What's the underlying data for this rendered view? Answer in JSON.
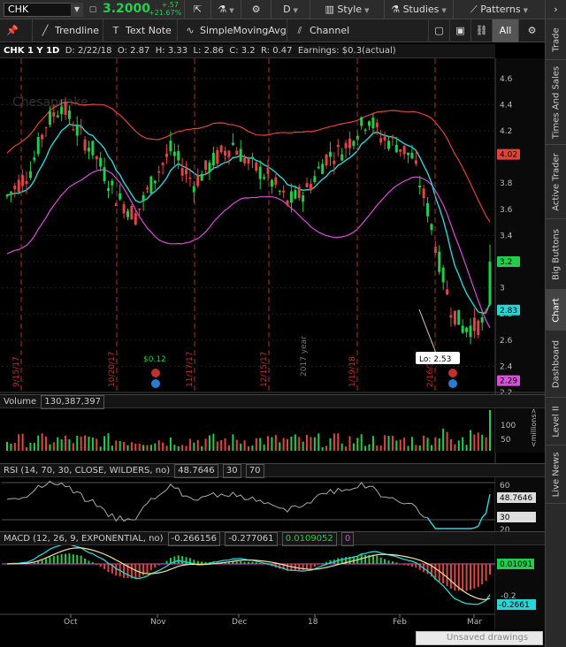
{
  "topbar": {
    "symbol": "CHK",
    "last_price": "3.2000",
    "net_change": "+.57",
    "net_change_pct": "+21.67%",
    "buttons": [
      {
        "name": "share-button",
        "icon": "share-icon",
        "label": ""
      },
      {
        "name": "flask-button",
        "icon": "flask-icon",
        "label": ""
      },
      {
        "name": "settings-button",
        "icon": "gear-icon",
        "label": ""
      },
      {
        "name": "aggregation-button",
        "icon": "",
        "label": "D"
      },
      {
        "name": "style-button",
        "icon": "bars-icon",
        "label": "Style"
      },
      {
        "name": "studies-button",
        "icon": "flask-icon",
        "label": "Studies"
      },
      {
        "name": "patterns-button",
        "icon": "pattern-icon",
        "label": "Patterns"
      }
    ]
  },
  "drawbar": {
    "pin_icon": "pin-icon",
    "trendline": "Trendline",
    "textnote": "Text Note",
    "sma": "SimpleMovingAvg",
    "channel": "Channel",
    "all": "All"
  },
  "sidetabs": [
    "Trade",
    "Times And Sales",
    "Active Trader",
    "Big Buttons",
    "Chart",
    "Dashboard",
    "Level II",
    "Live News"
  ],
  "chart_header": {
    "symbol": "CHK 1 Y 1D",
    "date": "D: 2/22/18",
    "open": "O: 2.87",
    "high": "H: 3.33",
    "low": "L: 2.86",
    "close": "C: 3.2",
    "range": "R: 0.47",
    "earnings": "Earnings: $0.3(actual)"
  },
  "price_axis": {
    "ticks": [
      "4.6",
      "4.4",
      "4.2",
      "4",
      "3.8",
      "3.6",
      "3.4",
      "3.2",
      "3",
      "2.8",
      "2.6",
      "2.4",
      "2.2"
    ],
    "badges": [
      {
        "label": "4.02",
        "value": 4.02,
        "color": "#e0453a"
      },
      {
        "label": "3.2",
        "value": 3.2,
        "color": "#1fcf4a"
      },
      {
        "label": "2.83",
        "value": 2.83,
        "color": "#29d6d6"
      },
      {
        "label": "2.29",
        "value": 2.29,
        "color": "#d84fd8"
      }
    ]
  },
  "event_markers": {
    "dates": [
      "9/15/17",
      "10/20/17",
      "11/17/17",
      "12/15/17",
      "1/19/18",
      "2/16/18"
    ],
    "year_label": "2017 year",
    "dividend": "$0.12",
    "low_label": "Lo: 2.53",
    "watermark": "Chesapeake"
  },
  "volume_panel": {
    "label": "Volume",
    "value": "130,387,397",
    "axis_ticks": [
      "100",
      "50"
    ],
    "unit": "<millions>"
  },
  "rsi_panel": {
    "label": "RSI (14, 70, 30, CLOSE, WILDERS, no)",
    "value": "48.7646",
    "low": "30",
    "high": "70",
    "axis_ticks": [
      "60",
      "48.7646",
      "30",
      "20"
    ]
  },
  "macd_panel": {
    "label": "MACD (12, 26, 9, EXPONENTIAL, no)",
    "value": "-0.266156",
    "avg": "-0.277061",
    "diff": "0.0109052",
    "zero": "0",
    "axis_ticks": [
      "0.01091",
      "-0.2",
      "-0.2661"
    ]
  },
  "time_axis": [
    "Oct",
    "Nov",
    "Dec",
    "18",
    "Feb",
    "Mar"
  ],
  "unsaved": "Unsaved drawings",
  "chart_data": {
    "type": "candlestick",
    "symbol": "CHK",
    "aggregation": "1D",
    "ylim": [
      2.2,
      4.7
    ],
    "close_series_monthly": {
      "x": [
        "Sep",
        "Oct",
        "Nov",
        "Dec",
        "Jan",
        "Feb"
      ],
      "values": [
        4.3,
        3.9,
        4.0,
        3.8,
        4.2,
        2.8
      ]
    },
    "last": {
      "date": "2/22/18",
      "open": 2.87,
      "high": 3.33,
      "low": 2.86,
      "close": 3.2,
      "volume": 130387397
    },
    "rsi_last": 48.7646,
    "macd_last": {
      "value": -0.266156,
      "avg": -0.277061,
      "diff": 0.0109052
    }
  }
}
